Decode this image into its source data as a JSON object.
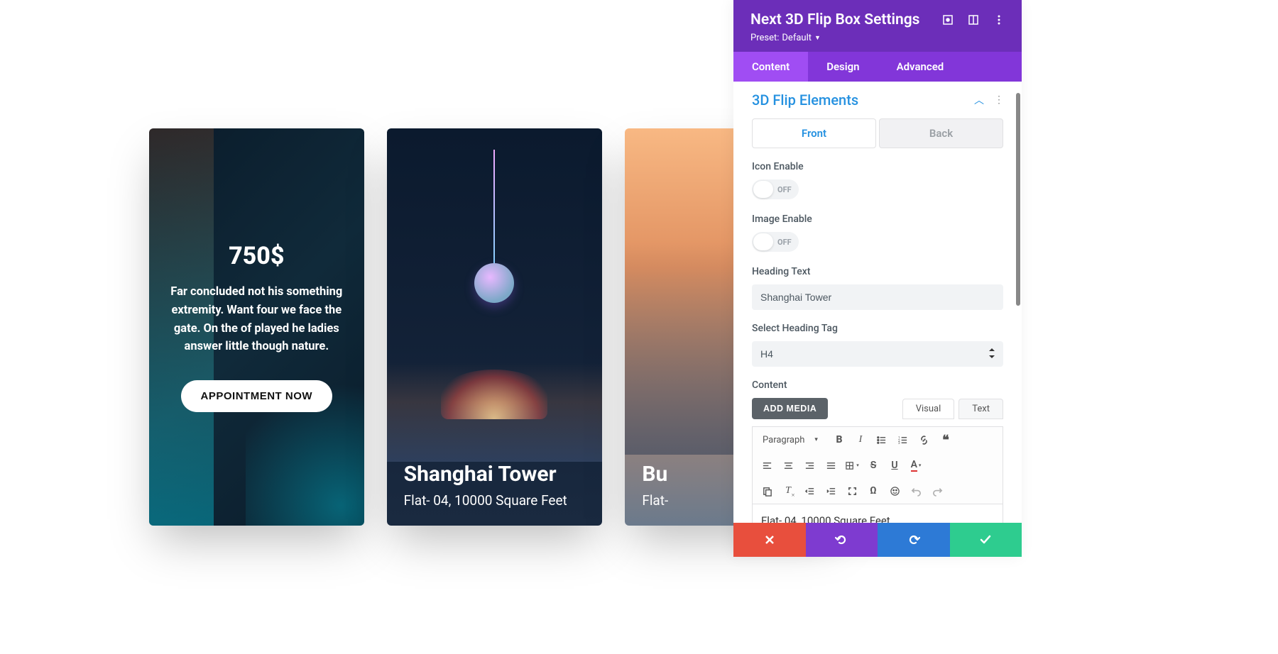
{
  "canvas": {
    "card1": {
      "price": "750$",
      "desc": "Far concluded not his something extremity. Want four we face the gate. On the of played he ladies answer little though nature.",
      "button": "APPOINTMENT NOW"
    },
    "card2": {
      "title": "Shanghai Tower",
      "sub": "Flat- 04, 10000 Square Feet"
    },
    "card3": {
      "title": "Bu",
      "sub": "Flat-"
    }
  },
  "panel": {
    "title": "Next 3D Flip Box Settings",
    "preset_label": "Preset:",
    "preset_value": "Default",
    "tabs": {
      "content": "Content",
      "design": "Design",
      "advanced": "Advanced"
    },
    "section": "3D Flip Elements",
    "subtabs": {
      "front": "Front",
      "back": "Back"
    },
    "fields": {
      "icon_enable": "Icon Enable",
      "image_enable": "Image Enable",
      "heading_text": "Heading Text",
      "heading_value": "Shanghai Tower",
      "heading_tag": "Select Heading Tag",
      "heading_tag_value": "H4",
      "content": "Content",
      "toggle_off": "OFF"
    },
    "editor": {
      "add_media": "ADD MEDIA",
      "visual": "Visual",
      "text": "Text",
      "format": "Paragraph",
      "content": "Flat- 04, 10000 Square Feet"
    }
  }
}
